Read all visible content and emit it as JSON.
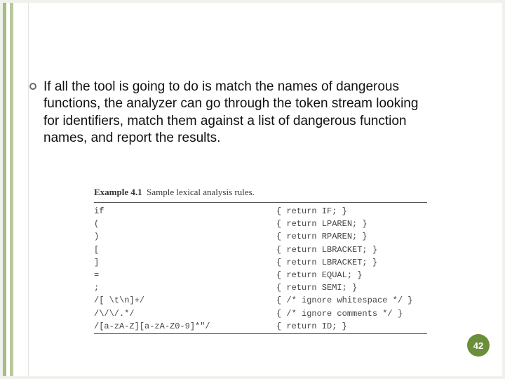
{
  "bullet": "If all the tool is going to do is match the names of dangerous functions, the analyzer can go through the token stream looking for identifiers, match them against a list of dangerous function names, and report the results.",
  "example": {
    "label": "Example 4.1",
    "caption": "Sample lexical analysis rules."
  },
  "rules": [
    {
      "pat": "if",
      "act": "{ return IF; }"
    },
    {
      "pat": "(",
      "act": "{ return LPAREN; }"
    },
    {
      "pat": ")",
      "act": "{ return RPAREN; }"
    },
    {
      "pat": "[",
      "act": "{ return LBRACKET; }"
    },
    {
      "pat": "]",
      "act": "{ return LBRACKET; }"
    },
    {
      "pat": "=",
      "act": "{ return EQUAL; }"
    },
    {
      "pat": ";",
      "act": "{ return SEMI; }"
    },
    {
      "pat": "/[ \\t\\n]+/",
      "act": "{ /* ignore whitespace */ }"
    },
    {
      "pat": "/\\/\\/.*/",
      "act": "{ /* ignore comments */ }"
    },
    {
      "pat": "/[a-zA-Z][a-zA-Z0-9]*\"/",
      "act": "{ return ID; }"
    }
  ],
  "page": "42"
}
